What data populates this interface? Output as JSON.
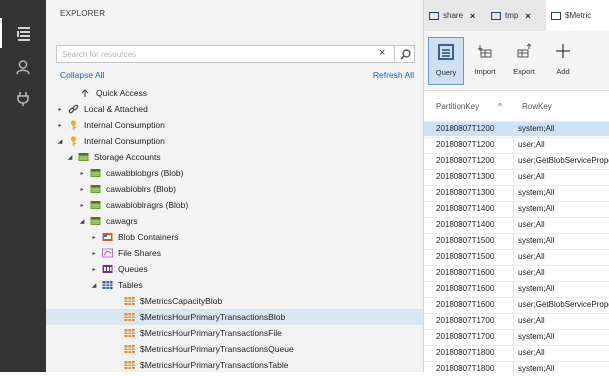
{
  "explorer": {
    "title": "EXPLORER",
    "search_placeholder": "Search for resources",
    "clear_glyph": "×",
    "collapse_all": "Collapse All",
    "refresh_all": "Refresh All"
  },
  "tree": [
    {
      "label": "Quick Access",
      "icon": "quick-access-icon",
      "chevron": "",
      "selected": false
    },
    {
      "label": "Local & Attached",
      "icon": "link-icon",
      "chevron": "▸",
      "selected": false
    },
    {
      "label": "Internal Consumption",
      "icon": "key-icon",
      "chevron": "▸",
      "selected": false
    },
    {
      "label": "Internal Consumption",
      "icon": "key-icon",
      "chevron": "◢",
      "selected": false
    },
    {
      "label": "Storage Accounts",
      "icon": "storage-accounts-icon",
      "chevron": "◢",
      "selected": false
    },
    {
      "label": "cawabblobgrs (Blob)",
      "icon": "storage-account-icon",
      "chevron": "▸",
      "selected": false
    },
    {
      "label": "cawabloblrs (Blob)",
      "icon": "storage-account-icon",
      "chevron": "▸",
      "selected": false
    },
    {
      "label": "cawabloblragrs (Blob)",
      "icon": "storage-account-icon",
      "chevron": "▸",
      "selected": false
    },
    {
      "label": "cawagrs",
      "icon": "storage-account-icon",
      "chevron": "◢",
      "selected": false
    },
    {
      "label": "Blob Containers",
      "icon": "blob-containers-icon",
      "chevron": "▸",
      "selected": false
    },
    {
      "label": "File Shares",
      "icon": "file-shares-icon",
      "chevron": "▸",
      "selected": false
    },
    {
      "label": "Queues",
      "icon": "queues-icon",
      "chevron": "▸",
      "selected": false
    },
    {
      "label": "Tables",
      "icon": "tables-icon",
      "chevron": "◢",
      "selected": false
    },
    {
      "label": "$MetricsCapacityBlob",
      "icon": "table-icon",
      "chevron": "",
      "selected": false
    },
    {
      "label": "$MetricsHourPrimaryTransactionsBlob",
      "icon": "table-icon",
      "chevron": "",
      "selected": true
    },
    {
      "label": "$MetricsHourPrimaryTransactionsFile",
      "icon": "table-icon",
      "chevron": "",
      "selected": false
    },
    {
      "label": "$MetricsHourPrimaryTransactionsQueue",
      "icon": "table-icon",
      "chevron": "",
      "selected": false
    },
    {
      "label": "$MetricsHourPrimaryTransactionsTable",
      "icon": "table-icon",
      "chevron": "",
      "selected": false
    }
  ],
  "tabs": [
    {
      "label": "share"
    },
    {
      "label": "tmp"
    },
    {
      "label": "$Metric"
    }
  ],
  "toolbar": [
    {
      "label": "Query",
      "icon": "query-icon"
    },
    {
      "label": "Import",
      "icon": "import-icon"
    },
    {
      "label": "Export",
      "icon": "export-icon"
    },
    {
      "label": "Add",
      "icon": "add-icon"
    }
  ],
  "grid": {
    "columns": [
      "PartitionKey",
      "RowKey"
    ],
    "sort_glyph": "^",
    "rows": [
      {
        "pk": "20180807T1200",
        "rk": "system;All",
        "selected": true
      },
      {
        "pk": "20180807T1200",
        "rk": "user;All",
        "selected": false
      },
      {
        "pk": "20180807T1200",
        "rk": "user;GetBlobServiceProperties",
        "selected": false
      },
      {
        "pk": "20180807T1300",
        "rk": "user;All",
        "selected": false
      },
      {
        "pk": "20180807T1300",
        "rk": "system;All",
        "selected": false
      },
      {
        "pk": "20180807T1400",
        "rk": "system;All",
        "selected": false
      },
      {
        "pk": "20180807T1400",
        "rk": "user;All",
        "selected": false
      },
      {
        "pk": "20180807T1500",
        "rk": "system;All",
        "selected": false
      },
      {
        "pk": "20180807T1500",
        "rk": "user;All",
        "selected": false
      },
      {
        "pk": "20180807T1600",
        "rk": "user;All",
        "selected": false
      },
      {
        "pk": "20180807T1600",
        "rk": "system;All",
        "selected": false
      },
      {
        "pk": "20180807T1600",
        "rk": "user;GetBlobServiceProperties",
        "selected": false
      },
      {
        "pk": "20180807T1700",
        "rk": "user;All",
        "selected": false
      },
      {
        "pk": "20180807T1700",
        "rk": "system;All",
        "selected": false
      },
      {
        "pk": "20180807T1800",
        "rk": "user;All",
        "selected": false
      },
      {
        "pk": "20180807T1800",
        "rk": "system;All",
        "selected": false
      }
    ]
  },
  "colors": {
    "activity_bar": "#333333",
    "link": "#1a62bf",
    "selection": "#cde2f7",
    "key_icon": "#f2b01e",
    "storage_icon": "#5f8b2a"
  }
}
